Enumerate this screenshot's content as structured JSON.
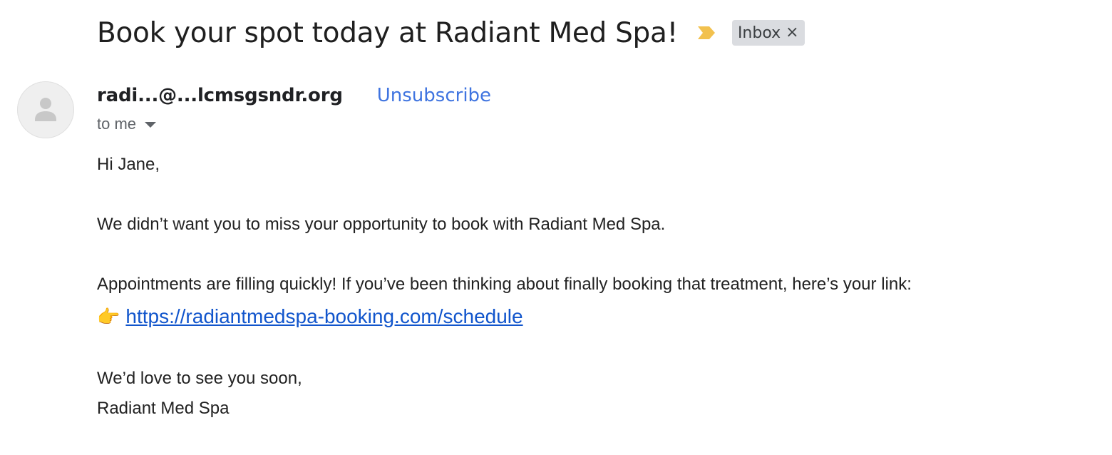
{
  "email": {
    "subject": "Book your spot today at Radiant Med Spa!",
    "importance_icon": "importance-marker-icon",
    "label": {
      "text": "Inbox",
      "remove_glyph": "×"
    },
    "sender": "radi...@...lcmsgsndr.org",
    "unsubscribe_label": "Unsubscribe",
    "recipient_label": "to me",
    "body": {
      "greeting": "Hi Jane,",
      "paragraph_1": "We didn’t want you to miss your opportunity to book with Radiant Med Spa.",
      "paragraph_2": "Appointments are filling quickly! If you’ve been thinking about finally booking that treatment, here’s your link:",
      "pointer_emoji": "👉",
      "link_url": "https://radiantmedspa-booking.com/schedule",
      "closing": "We’d love to see you soon,",
      "signature": "Radiant Med Spa"
    }
  },
  "colors": {
    "link_blue": "#1155cc",
    "unsubscribe_blue": "#3f74e0",
    "importance_yellow": "#f2c14e",
    "label_bg": "#dadce0"
  }
}
